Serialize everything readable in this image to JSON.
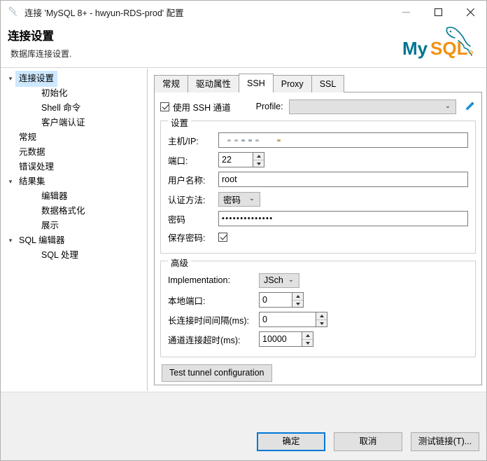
{
  "window": {
    "title": "连接 'MySQL 8+ - hwyun-RDS-prod' 配置",
    "app_icon": "connection-icon",
    "minimize_label": "minimize",
    "maximize_label": "maximize",
    "close_label": "close"
  },
  "header": {
    "title": "连接设置",
    "subtitle": "数据库连接设置.",
    "logo_text_1": "My",
    "logo_text_2": "SQL",
    "logo_colors": {
      "teal": "#00758f",
      "orange": "#f29111"
    }
  },
  "sidebar": {
    "items": [
      {
        "label": "连接设置",
        "level": 0,
        "twisty": "▾",
        "selected": true
      },
      {
        "label": "初始化",
        "level": 1,
        "twisty": "",
        "selected": false
      },
      {
        "label": "Shell 命令",
        "level": 1,
        "twisty": "",
        "selected": false
      },
      {
        "label": "客户端认证",
        "level": 1,
        "twisty": "",
        "selected": false
      },
      {
        "label": "常规",
        "level": 0,
        "twisty": "",
        "selected": false
      },
      {
        "label": "元数据",
        "level": 0,
        "twisty": "",
        "selected": false
      },
      {
        "label": "错误处理",
        "level": 0,
        "twisty": "",
        "selected": false
      },
      {
        "label": "结果集",
        "level": 0,
        "twisty": "▾",
        "selected": false
      },
      {
        "label": "编辑器",
        "level": 1,
        "twisty": "",
        "selected": false
      },
      {
        "label": "数据格式化",
        "level": 1,
        "twisty": "",
        "selected": false
      },
      {
        "label": "展示",
        "level": 1,
        "twisty": "",
        "selected": false
      },
      {
        "label": "SQL 编辑器",
        "level": 0,
        "twisty": "▾",
        "selected": false
      },
      {
        "label": "SQL 处理",
        "level": 1,
        "twisty": "",
        "selected": false
      }
    ],
    "selection_color": "#cde8ff"
  },
  "tabs": [
    {
      "label": "常规",
      "active": false
    },
    {
      "label": "驱动属性",
      "active": false
    },
    {
      "label": "SSH",
      "active": true
    },
    {
      "label": "Proxy",
      "active": false
    },
    {
      "label": "SSL",
      "active": false
    }
  ],
  "ssh": {
    "use_tunnel_label": "使用 SSH 通道",
    "use_tunnel_checked": true,
    "profile_label": "Profile:",
    "profile_value": "",
    "profile_edit_icon": "pencil-icon",
    "settings": {
      "group_title": "设置",
      "host_label": "主机/IP:",
      "host_value": "",
      "port_label": "端口:",
      "port_value": "22",
      "user_label": "用户名称:",
      "user_value": "root",
      "auth_label": "认证方法:",
      "auth_value": "密码",
      "password_label": "密码",
      "password_value": "••••••••••••••",
      "save_password_label": "保存密码:",
      "save_password_checked": true
    },
    "advanced": {
      "group_title": "高级",
      "implementation_label": "Implementation:",
      "implementation_value": "JSch",
      "local_port_label": "本地端口:",
      "local_port_value": "0",
      "keepalive_label": "长连接时间间隔(ms):",
      "keepalive_value": "0",
      "timeout_label": "通道连接超时(ms):",
      "timeout_value": "10000",
      "test_button_label": "Test tunnel configuration"
    }
  },
  "footer": {
    "ok_label": "确定",
    "cancel_label": "取消",
    "test_label": "测试链接(T)...",
    "accent_color": "#0078d7"
  }
}
